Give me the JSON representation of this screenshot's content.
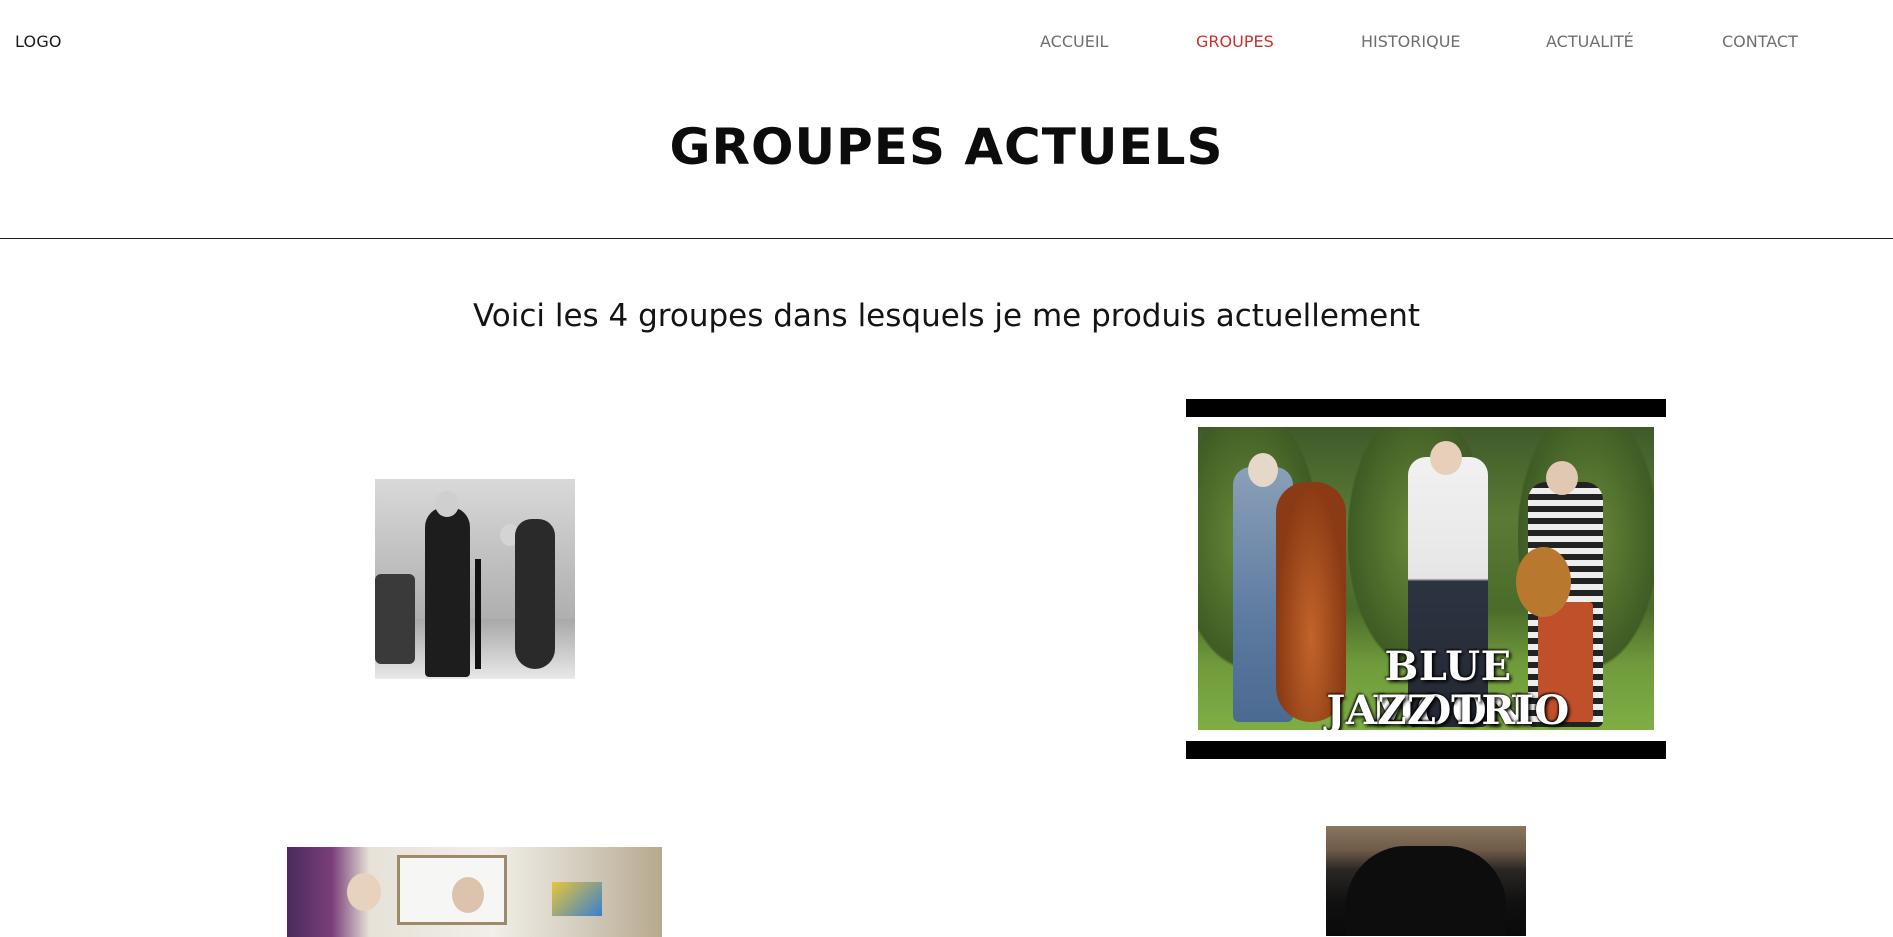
{
  "nav": {
    "logo": "LOGO",
    "links": [
      {
        "label": "ACCUEIL",
        "active": false
      },
      {
        "label": "GROUPES",
        "active": true
      },
      {
        "label": "HISTORIQUE",
        "active": false
      },
      {
        "label": "ACTUALITÉ",
        "active": false
      },
      {
        "label": "CONTACT",
        "active": false
      }
    ]
  },
  "page": {
    "title": "GROUPES ACTUELS",
    "intro": "Voici les 4 groupes dans lesquels je me produis actuellement"
  },
  "groups": {
    "poster_text": [
      "BLUE MOON",
      "JAZZ TRIO"
    ]
  },
  "colors": {
    "active_link": "#c7312f",
    "nav_link": "#6f6f6f",
    "title": "#0c0c0c"
  }
}
